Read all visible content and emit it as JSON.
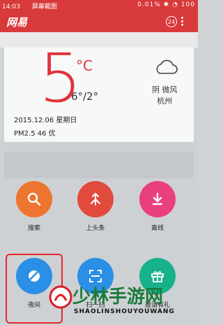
{
  "status_bar": {
    "time": "14:03",
    "center_text": "屏幕截图",
    "speed": "0.01%",
    "battery": "100"
  },
  "app_bar": {
    "logo": "网易",
    "badge_count": "24"
  },
  "weather": {
    "temperature": "5",
    "unit": "°C",
    "range": "6°/2°",
    "condition": "阴 微风",
    "city": "杭州",
    "date": "2015.12.06 星期日",
    "pm25": "PM2.5 46 优"
  },
  "grid": {
    "items": [
      {
        "label": "搜索",
        "icon": "search-icon",
        "color": "#ee7530"
      },
      {
        "label": "上头条",
        "icon": "merge-arrow-icon",
        "color": "#e14b3d"
      },
      {
        "label": "离线",
        "icon": "download-icon",
        "color": "#ea3f7d"
      },
      {
        "label": "夜间",
        "icon": "night-mode-icon",
        "color": "#2a8fe5"
      },
      {
        "label": "扫一扫",
        "icon": "scan-icon",
        "color": "#2a8fe5"
      },
      {
        "label": "邀请有礼",
        "icon": "gift-icon",
        "color": "#17b28b"
      }
    ]
  },
  "watermark": {
    "title": "少林手游网",
    "subtitle": "SHAOLINSHOUYOUWANG"
  },
  "colors": {
    "brand_red": "#d8393a",
    "annotation_red": "#e8262c",
    "watermark_green": "#1c7a3b"
  }
}
